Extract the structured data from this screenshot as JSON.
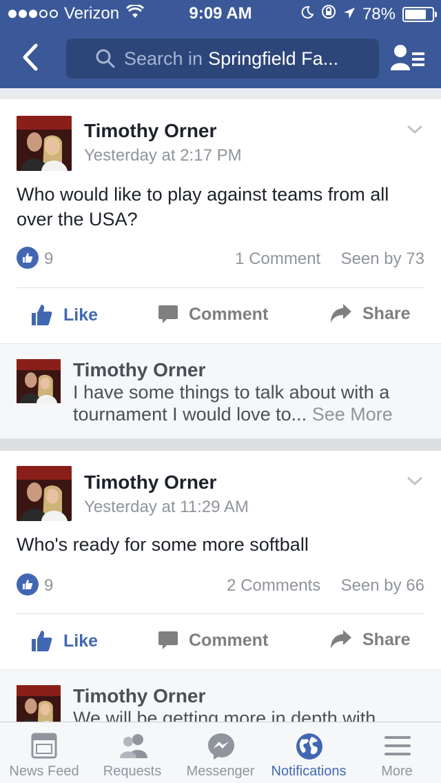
{
  "status_bar": {
    "carrier": "Verizon",
    "time": "9:09 AM",
    "battery": "78%",
    "battery_level": 0.78
  },
  "nav": {
    "search_prefix": "Search in",
    "search_term": "Springfield Fa..."
  },
  "posts": [
    {
      "author": "Timothy Orner",
      "timestamp": "Yesterday at 2:17 PM",
      "text": "Who would like to play against teams from all over the USA?",
      "likes": "9",
      "comments": "1 Comment",
      "seen": "Seen by 73",
      "actions": {
        "like": "Like",
        "comment": "Comment",
        "share": "Share"
      },
      "comment_preview": {
        "author": "Timothy Orner",
        "text": "I have some things to talk about with a tournament I would love to...",
        "see_more": "See More"
      }
    },
    {
      "author": "Timothy Orner",
      "timestamp": "Yesterday at 11:29 AM",
      "text": "Who's ready for some more softball",
      "likes": "9",
      "comments": "2 Comments",
      "seen": "Seen by 66",
      "actions": {
        "like": "Like",
        "comment": "Comment",
        "share": "Share"
      },
      "comment_preview": {
        "author": "Timothy Orner",
        "text": "We will be getting more in depth with"
      }
    }
  ],
  "tabs": [
    {
      "label": "News Feed",
      "icon": "news-feed-icon"
    },
    {
      "label": "Requests",
      "icon": "requests-icon"
    },
    {
      "label": "Messenger",
      "icon": "messenger-icon"
    },
    {
      "label": "Notifications",
      "icon": "globe-icon",
      "active": true
    },
    {
      "label": "More",
      "icon": "menu-icon"
    }
  ],
  "colors": {
    "brand": "#3b5998",
    "accent": "#4267b2",
    "muted": "#90949c"
  }
}
